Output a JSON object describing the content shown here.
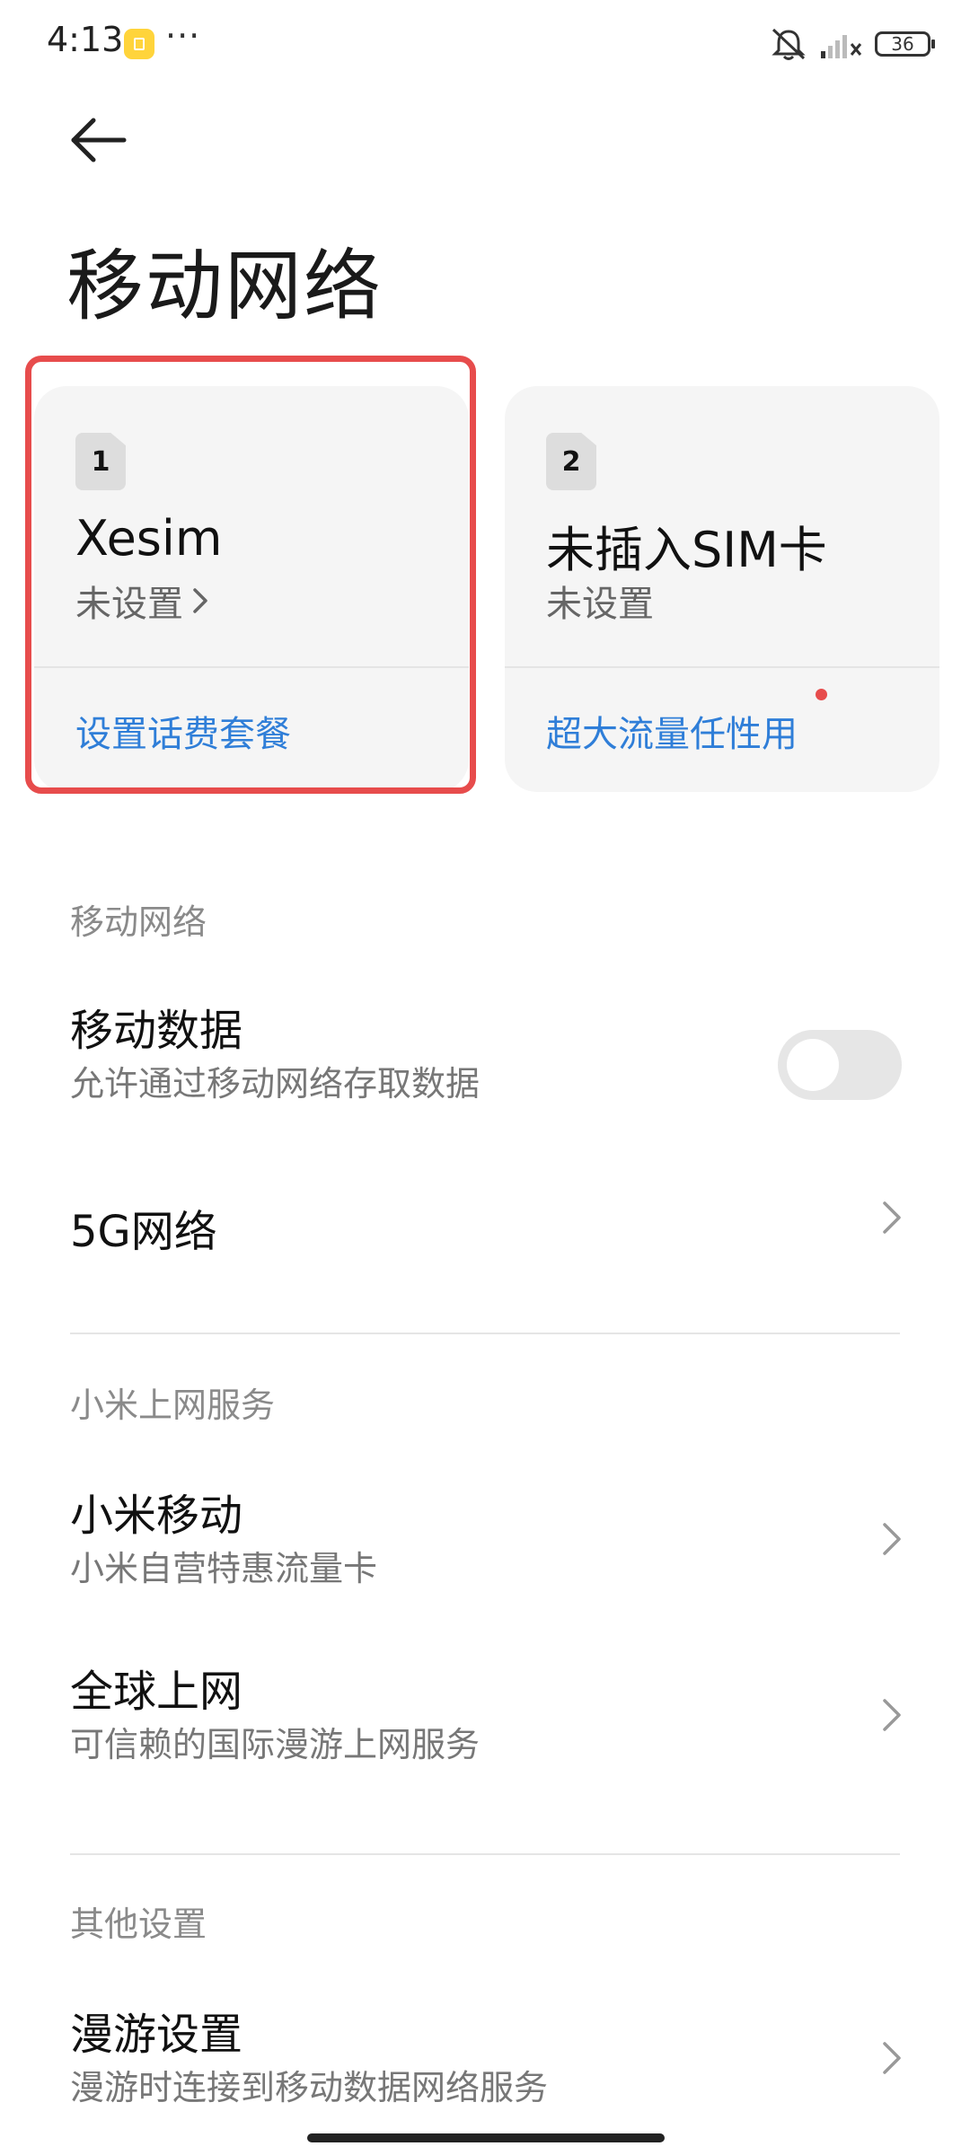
{
  "status_bar": {
    "time": "4:13",
    "overflow": "···",
    "icons": [
      "app-notification-icon",
      "mute-icon",
      "signal-icon"
    ],
    "battery_level": "36"
  },
  "header": {
    "title": "移动网络"
  },
  "sims": [
    {
      "slot": "1",
      "name": "Xesim",
      "status": "未设置",
      "action": "设置话费套餐"
    },
    {
      "slot": "2",
      "name": "未插入SIM卡",
      "status": "未设置",
      "action": "超大流量任性用"
    }
  ],
  "sections": {
    "mobile_network": {
      "header": "移动网络",
      "mobile_data": {
        "title": "移动数据",
        "subtitle": "允许通过移动网络存取数据",
        "enabled": false
      },
      "five_g": {
        "title": "5G网络"
      }
    },
    "xiaomi_services": {
      "header": "小米上网服务",
      "xiaomi_mobile": {
        "title": "小米移动",
        "subtitle": "小米自营特惠流量卡"
      },
      "global_internet": {
        "title": "全球上网",
        "subtitle": "可信赖的国际漫游上网服务"
      }
    },
    "other": {
      "header": "其他设置",
      "roaming": {
        "title": "漫游设置",
        "subtitle": "漫游时连接到移动数据网络服务"
      }
    }
  },
  "colors": {
    "accent": "#2f7ed8",
    "highlight": "#e74c4c",
    "card_bg": "#f5f5f5"
  }
}
